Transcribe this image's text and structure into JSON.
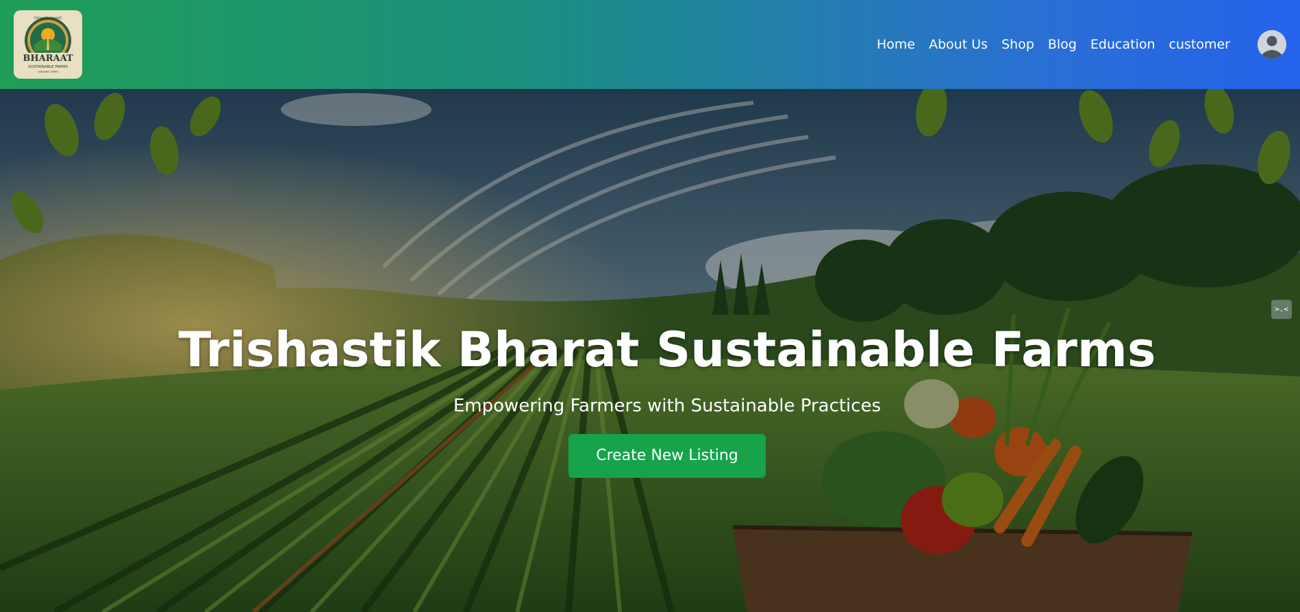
{
  "brand": {
    "logo_text": "BHARAAT",
    "logo_tagline": "SUSTAINABLE FARMS",
    "logo_top": "TRISHASTIK BHARAT",
    "logo_bottom": "ORGANIC FARM"
  },
  "nav": {
    "items": [
      {
        "label": "Home",
        "icon": null
      },
      {
        "label": "About Us",
        "icon": null
      },
      {
        "label": "Shop",
        "icon": null
      },
      {
        "label": "Blog",
        "icon": null
      },
      {
        "label": "Education",
        "icon": null
      },
      {
        "label": "customer",
        "icon": null
      }
    ],
    "avatar_icon": "user-avatar-icon"
  },
  "hero": {
    "title": "Trishastik Bharat Sustainable Farms",
    "subtitle": "Empowering Farmers with Sustainable Practices",
    "cta_label": "Create New Listing",
    "side_widget_icon": "collapse-icon",
    "side_widget_glyph": ">.<"
  },
  "colors": {
    "header_gradient_start": "#1f9e57",
    "header_gradient_end": "#2563eb",
    "cta": "#16a34a",
    "text": "#ffffff"
  }
}
